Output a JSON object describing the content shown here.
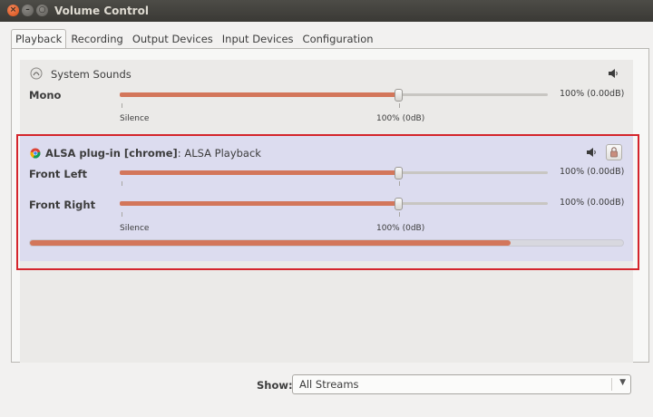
{
  "window": {
    "title": "Volume Control"
  },
  "tabs": [
    "Playback",
    "Recording",
    "Output Devices",
    "Input Devices",
    "Configuration"
  ],
  "streams": [
    {
      "name": "System Sounds",
      "icon": "sound-notification-icon",
      "channels": [
        {
          "label": "Mono",
          "value_text": "100% (0.00dB)",
          "level": 1.0
        }
      ],
      "scale": {
        "min_label": "Silence",
        "ref_label": "100% (0dB)"
      }
    },
    {
      "name_bold": "ALSA plug-in [chrome]",
      "name_rest": ": ALSA Playback",
      "icon": "chrome-icon",
      "channels": [
        {
          "label": "Front Left",
          "value_text": "100% (0.00dB)",
          "level": 1.0
        },
        {
          "label": "Front Right",
          "value_text": "100% (0.00dB)",
          "level": 1.0
        }
      ],
      "scale": {
        "min_label": "Silence",
        "ref_label": "100% (0dB)"
      },
      "peak_level": 0.81
    }
  ],
  "show": {
    "label": "Show:",
    "value": "All Streams"
  },
  "colors": {
    "accent": "#d3765a",
    "highlight_border": "#d4252c",
    "selected_row": "#dcdcef"
  }
}
